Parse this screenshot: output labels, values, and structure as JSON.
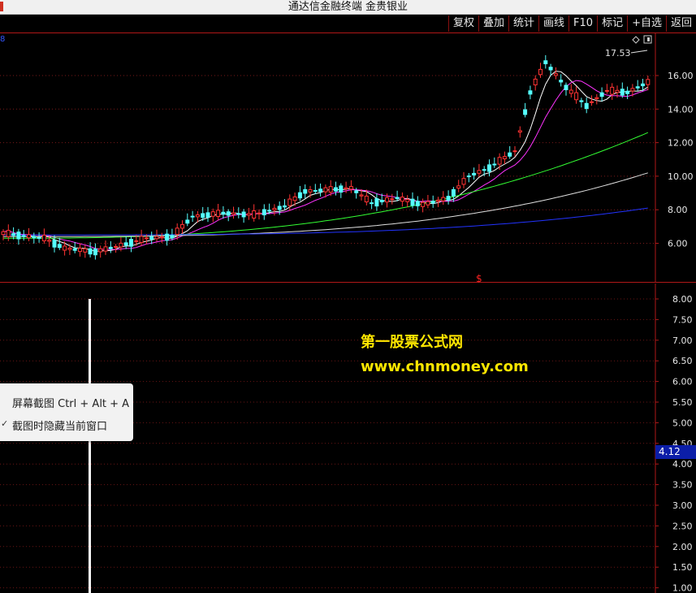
{
  "window": {
    "title": "通达信金融终端 金贵银业"
  },
  "toolbar": {
    "buttons": [
      "复权",
      "叠加",
      "统计",
      "画线",
      "F10",
      "标记",
      "+自选",
      "返回"
    ]
  },
  "main_chart": {
    "period_label": "8",
    "y_axis_ticks": [
      "16.00",
      "14.00",
      "12.00",
      "10.00",
      "8.00",
      "6.00"
    ],
    "max_price_label": "17.53",
    "signal_marker": "$",
    "colors": {
      "up": "#ff3333",
      "down": "#55ffff",
      "ma5": "#ffffff",
      "ma10": "#ff33ff",
      "ma20": "#33ff33",
      "ma60": "#e0e0e0",
      "ma120": "#2233ff"
    }
  },
  "sub_chart": {
    "y_axis_ticks": [
      "8.00",
      "7.50",
      "7.00",
      "6.50",
      "6.00",
      "5.50",
      "5.00",
      "4.50",
      "4.00",
      "3.50",
      "3.00",
      "2.50",
      "2.00",
      "1.50",
      "1.00"
    ],
    "current_value": "4.12"
  },
  "watermark": {
    "line1": "第一股票公式网",
    "line2": "www.chnmoney.com"
  },
  "context_menu": {
    "items": [
      "屏幕截图 Ctrl + Alt + A",
      "截图时隐藏当前窗口"
    ],
    "checked_marker": "✓"
  }
}
